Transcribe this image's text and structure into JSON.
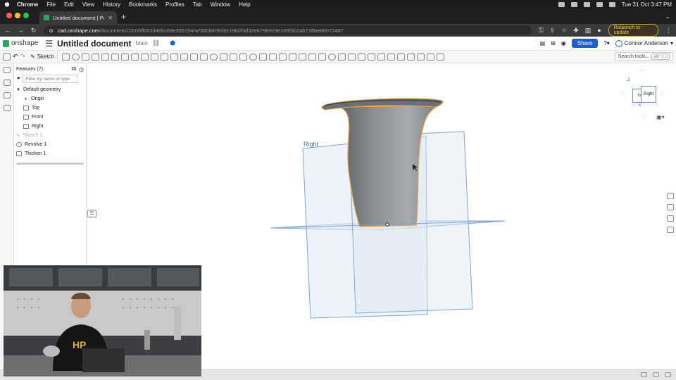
{
  "menubar": {
    "app": "Chrome",
    "items": [
      "File",
      "Edit",
      "View",
      "History",
      "Bookmarks",
      "Profiles",
      "Tab",
      "Window",
      "Help"
    ],
    "clock": "Tue 31 Oct  3:47 PM"
  },
  "browser": {
    "tab_title": "Untitled document | Part Studio",
    "url_host": "cad.onshape.com",
    "url_path": "/documents/1fc05ffc82d4ebc69e305154/w/36084063b119b0f3d32e6796/e/3e103f3b2ab738be88072467",
    "relaunch_label": "Relaunch to update"
  },
  "onshape": {
    "brand": "onshape",
    "doc_title": "Untitled document",
    "branch": "Main",
    "share_label": "Share",
    "user_name": "Connor Anderson",
    "sketch_label": "Sketch",
    "search_tools": "Search tools...",
    "search_shortcut": "alt/⌥ c"
  },
  "features": {
    "title": "Features (7)",
    "filter_placeholder": "Filter by name or type",
    "group": "Default geometry",
    "items": [
      {
        "label": "Origin",
        "kind": "origin"
      },
      {
        "label": "Top",
        "kind": "plane"
      },
      {
        "label": "Front",
        "kind": "plane"
      },
      {
        "label": "Right",
        "kind": "plane"
      },
      {
        "label": "Sketch 1",
        "kind": "sketch"
      },
      {
        "label": "Revolve 1",
        "kind": "revolve"
      },
      {
        "label": "Thicken 1",
        "kind": "thicken"
      }
    ]
  },
  "viewport": {
    "plane_label": "Right"
  },
  "viewcube": {
    "front_face": "Top",
    "right_face": "Right",
    "axis_z": "Z",
    "axis_x": "X"
  },
  "colors": {
    "accent": "#1c5fc6",
    "onshape_green": "#2aa55f",
    "plane_fill": "#dde9f5",
    "plane_edge": "#7fa4cf",
    "part_edge": "#f0a23c",
    "relaunch": "#f0c860"
  }
}
